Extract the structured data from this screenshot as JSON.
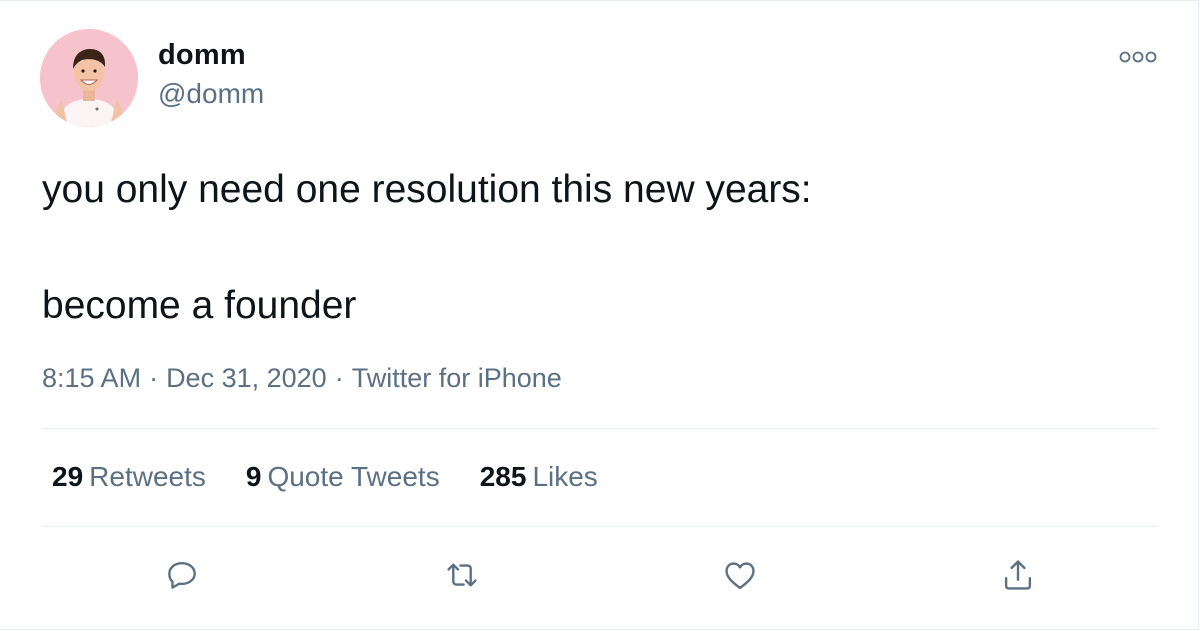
{
  "author": {
    "display_name": "domm",
    "handle": "@domm"
  },
  "tweet": {
    "text": "you only need one resolution this new years:\n\nbecome a founder",
    "time": "8:15 AM",
    "date": "Dec 31, 2020",
    "separator": "·",
    "source": "Twitter for iPhone"
  },
  "stats": {
    "retweets_count": "29",
    "retweets_label": "Retweets",
    "quotes_count": "9",
    "quotes_label": "Quote Tweets",
    "likes_count": "285",
    "likes_label": "Likes"
  },
  "icons": {
    "more": "more-icon",
    "reply": "reply-icon",
    "retweet": "retweet-icon",
    "like": "heart-icon",
    "share": "share-icon"
  },
  "colors": {
    "text_primary": "#0f1419",
    "text_secondary": "#5b7083",
    "divider": "#e6ecf0",
    "avatar_bg": "#f7c6cf"
  }
}
